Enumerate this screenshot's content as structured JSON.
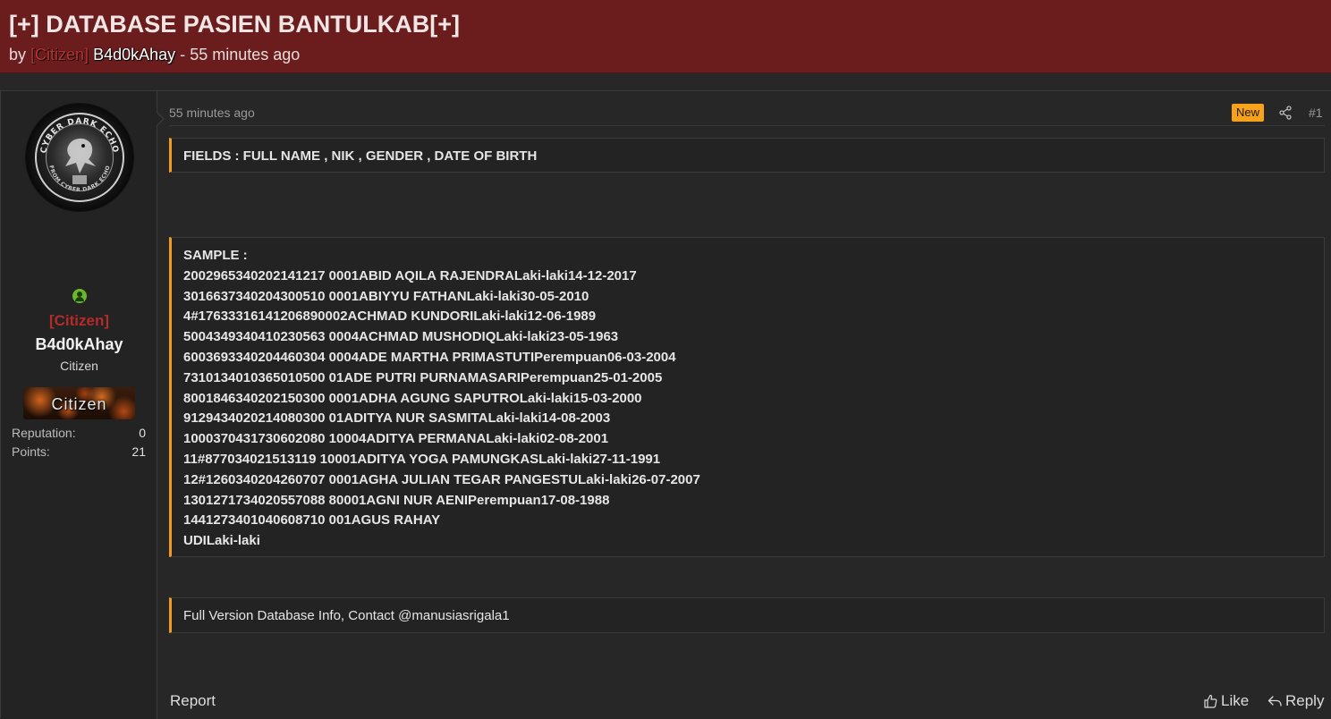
{
  "thread": {
    "title": "[+] DATABASE PASIEN BANTULKAB[+]",
    "by_label": "by",
    "author_rank_tag": "[Citizen]",
    "author_name": "B4d0kAhay",
    "separator": "-",
    "posted_ago": "55 minutes ago"
  },
  "user": {
    "avatar_text": "CYBER DARK ECHO",
    "avatar_subtext": "FROM CYBER DARK ECHO",
    "rank_tag": "[Citizen]",
    "name": "B4d0kAhay",
    "title": "Citizen",
    "banner": "Citizen",
    "stats": [
      {
        "label": "Reputation:",
        "value": "0"
      },
      {
        "label": "Points:",
        "value": "21"
      }
    ]
  },
  "post": {
    "date": "55 minutes ago",
    "new_badge": "New",
    "number": "#1",
    "fields_text": "FIELDS : FULL NAME , NIK , GENDER , DATE OF BIRTH",
    "sample_lines": [
      "SAMPLE :",
      "2002965340202141217 0001ABID AQILA RAJENDRALaki-laki14-12-2017",
      "3016637340204300510 0001ABIYYU FATHANLaki-laki30-05-2010",
      "4#17633316141206890002ACHMAD KUNDORILaki-laki12-06-1989",
      "5004349340410230563 0004ACHMAD MUSHODIQLaki-laki23-05-1963",
      "6003693340204460304 0004ADE MARTHA PRIMASTUTIPerempuan06-03-2004",
      "7310134010365010500 01ADE PUTRI PURNAMASARIPerempuan25-01-2005",
      "8001846340202150300 0001ADHA AGUNG SAPUTROLaki-laki15-03-2000",
      "9129434020214080300 01ADITYA NUR SASMITALaki-laki14-08-2003",
      "1000370431730602080 10004ADITYA PERMANALaki-laki02-08-2001",
      "11#877034021513119 10001ADITYA YOGA PAMUNGKASLaki-laki27-11-1991",
      "12#1260340204260707 0001AGHA JULIAN TEGAR PANGESTULaki-laki26-07-2007",
      "1301271734020557088 80001AGNI NUR AENIPerempuan17-08-1988",
      "1441273401040608710 001AGUS RAHAY",
      "UDILaki-laki"
    ],
    "contact_text": "Full Version Database Info, Contact @manusiasrigala1"
  },
  "actions": {
    "report": "Report",
    "like": "Like",
    "reply": "Reply"
  },
  "colors": {
    "header_bg": "#6b1d1e",
    "accent": "#f09b21",
    "rank_red": "#b52a2a",
    "online_green": "#6bb82d",
    "page_bg": "#272727"
  },
  "icons": {
    "share": "share-icon",
    "like": "thumbs-up-icon",
    "reply": "reply-arrow-icon",
    "online": "online-status-icon"
  }
}
